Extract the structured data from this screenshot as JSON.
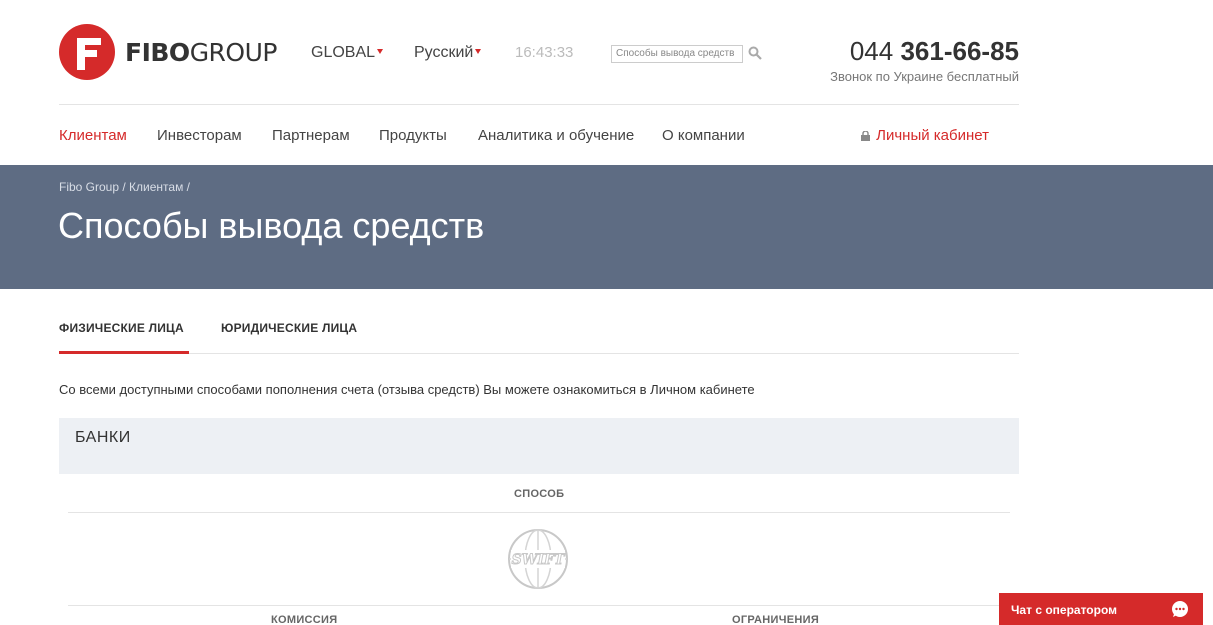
{
  "brand": {
    "name_bold": "FIBO",
    "name_light": "GROUP"
  },
  "header": {
    "region": "GLOBAL",
    "language": "Русский",
    "time": "16:43:33",
    "search_placeholder": "Способы вывода средств",
    "phone_prefix": "044 ",
    "phone_number": "361-66-85",
    "phone_note": "Звонок по Украине бесплатный"
  },
  "nav": {
    "items": [
      {
        "label": "Клиентам",
        "active": true
      },
      {
        "label": "Инвесторам"
      },
      {
        "label": "Партнерам"
      },
      {
        "label": "Продукты"
      },
      {
        "label": "Аналитика и обучение"
      },
      {
        "label": "О компании"
      }
    ],
    "cabinet": "Личный кабинет"
  },
  "breadcrumb": "Fibo Group / Клиентам /",
  "page_title": "Способы вывода средств",
  "tabs": [
    {
      "label": "ФИЗИЧЕСКИЕ ЛИЦА",
      "active": true
    },
    {
      "label": "ЮРИДИЧЕСКИЕ ЛИЦА"
    }
  ],
  "info_text": "Со всеми доступными способами пополнения счета (отзыва средств) Вы можете ознакомиться в Личном кабинете",
  "section": {
    "title": "БАНКИ",
    "method_header": "СПОСОБ",
    "method_logo": "SWIFT",
    "commission_header": "КОМИССИЯ",
    "limits_header": "ОГРАНИЧЕНИЯ"
  },
  "chat": {
    "label": "Чат с оператором"
  },
  "colors": {
    "accent": "#d52a2a",
    "banner": "#5e6c83",
    "section_bg": "#edf0f4"
  }
}
